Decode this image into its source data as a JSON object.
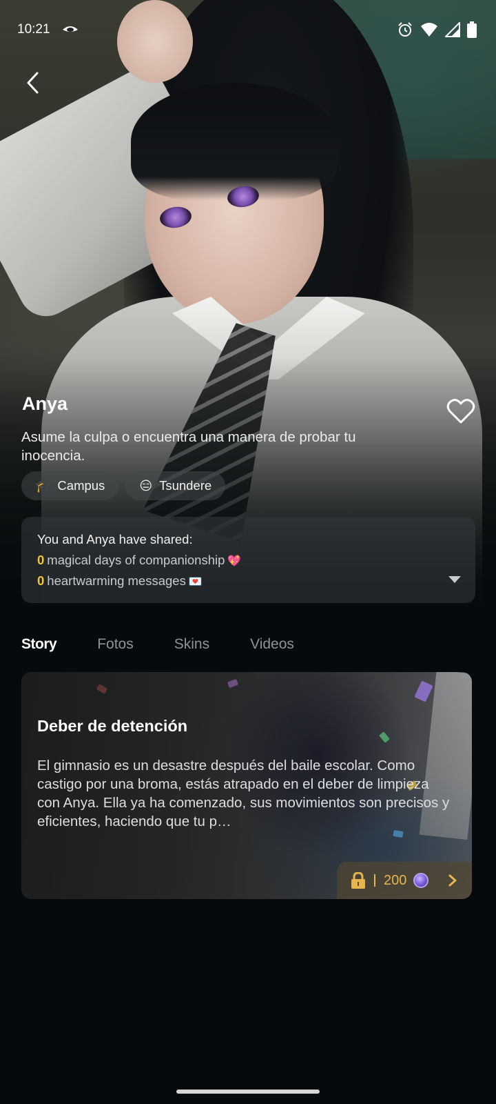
{
  "status_bar": {
    "time": "10:21",
    "icons": [
      "eye-icon",
      "alarm-icon",
      "wifi-icon",
      "signal-icon",
      "battery-icon"
    ]
  },
  "header": {
    "back_icon": "chevron-left-icon"
  },
  "profile": {
    "name": "Anya",
    "tagline": "Asume la culpa o encuentra una manera de probar tu inocencia.",
    "favorite_icon": "heart-outline-icon",
    "tags": [
      {
        "emoji": "🎓",
        "label": "Campus"
      },
      {
        "emoji": "😑",
        "label": "Tsundere"
      }
    ]
  },
  "shared": {
    "title": "You and Anya have shared:",
    "days_count": "0",
    "days_text": "magical days of companionship",
    "days_emoji": "💖",
    "messages_count": "0",
    "messages_text": "heartwarming messages",
    "messages_emoji": "💌",
    "expand_icon": "caret-down-icon"
  },
  "tabs": [
    {
      "label": "Story",
      "active": true
    },
    {
      "label": "Fotos",
      "active": false
    },
    {
      "label": "Skins",
      "active": false
    },
    {
      "label": "Videos",
      "active": false
    }
  ],
  "story_card": {
    "title": "Deber de detención",
    "description": "El gimnasio es un desastre después del baile escolar. Como castigo por una broma, estás atrapado en el deber de limpieza con Anya. Ella ya ha comenzado, sus movimientos son precisos y eficientes, haciendo que tu p…",
    "price": "200",
    "lock_icon": "lock-icon",
    "currency_icon": "gem-coin-icon",
    "go_icon": "chevron-right-icon"
  },
  "colors": {
    "background": "#060a0c",
    "accent_yellow": "#f0c43b",
    "price_gold": "#e6b64e",
    "tab_inactive": "#8f9397"
  }
}
